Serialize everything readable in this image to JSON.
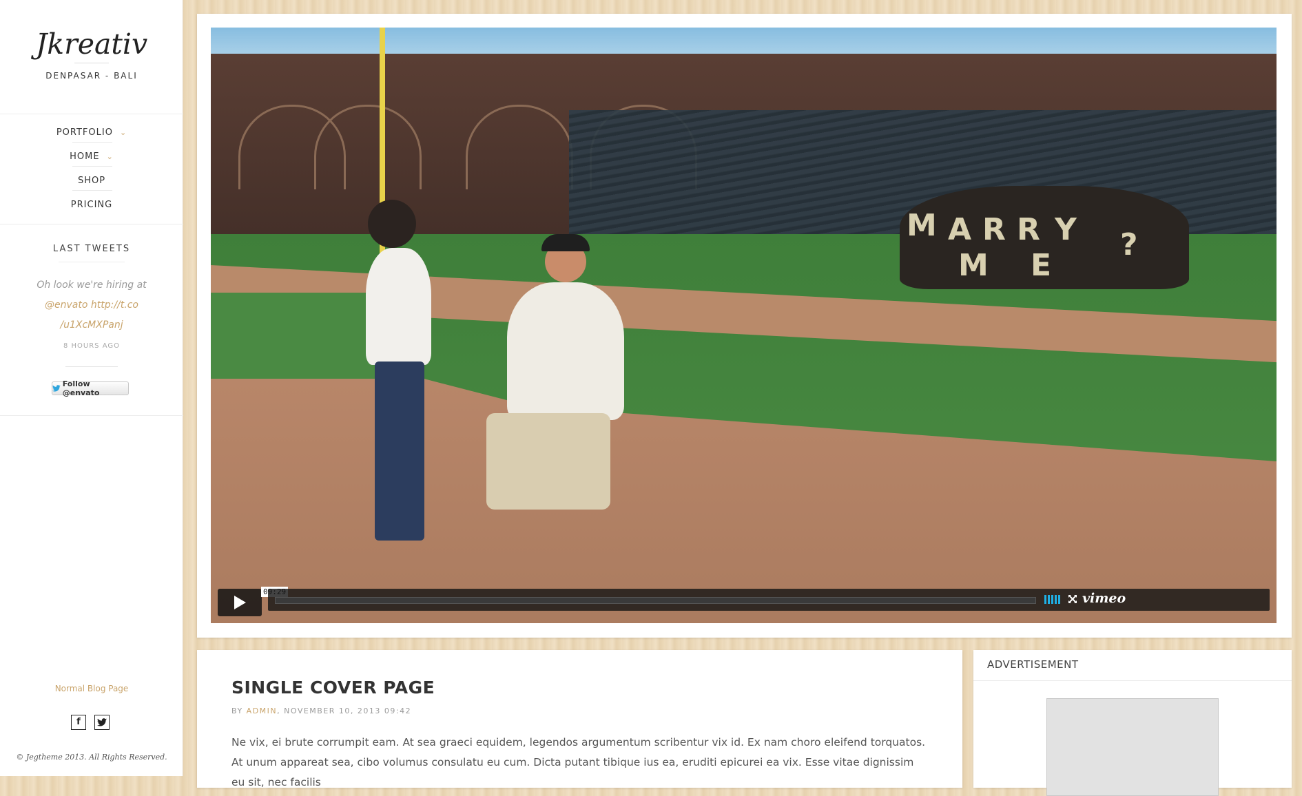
{
  "sidebar": {
    "logo": "Jkreativ",
    "tagline": "DENPASAR - BALI",
    "menu": [
      {
        "label": "PORTFOLIO",
        "has_children": true
      },
      {
        "label": "HOME",
        "has_children": true
      },
      {
        "label": "SHOP",
        "has_children": false
      },
      {
        "label": "PRICING",
        "has_children": false
      }
    ],
    "tweets": {
      "title": "LAST TWEETS",
      "text_plain": "Oh look we're hiring at",
      "text_link_1": "@envato",
      "text_link_2": "http://t.co",
      "text_link_3": "/u1XcMXPanj",
      "time": "8 HOURS AGO",
      "follow_label": "Follow @envato"
    },
    "footer_link": "Normal Blog Page",
    "social": {
      "facebook": "f",
      "twitter_icon": "twitter-bird"
    },
    "copyright": "© Jegtheme 2013. All Rights Reserved."
  },
  "video": {
    "duration": "09:29",
    "progress": 0.0,
    "brand": "vimeo",
    "sign_letters": [
      "M",
      "A",
      "R",
      "R",
      "Y",
      "M",
      "E",
      "?"
    ]
  },
  "post": {
    "title": "SINGLE COVER PAGE",
    "meta_by": "BY",
    "meta_author": "ADMIN",
    "meta_date": ", NOVEMBER 10, 2013 09:42",
    "body": "Ne vix, ei brute corrumpit eam. At sea graeci equidem, legendos argumentum scribentur vix id. Ex nam choro eleifend torquatos. At unum appareat sea, cibo volumus consulatu eu cum. Dicta putant tibique ius ea, eruditi epicurei ea vix. Esse vitae dignissim eu sit, nec facilis"
  },
  "advertisement": {
    "title": "ADVERTISEMENT"
  },
  "colors": {
    "accent": "#c9a46b",
    "vimeo_blue": "#1fb0e6"
  }
}
